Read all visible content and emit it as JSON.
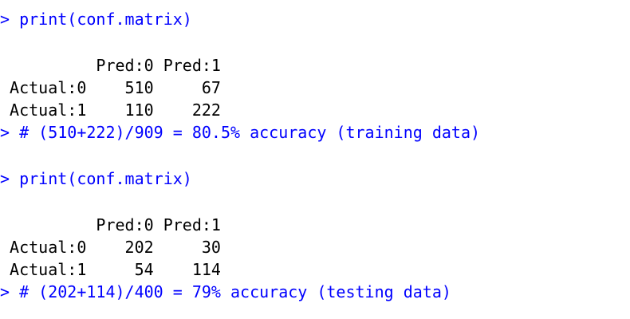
{
  "console": {
    "blocks": [
      {
        "command": "> print(conf.matrix)",
        "header": "          Pred:0 Pred:1",
        "rows": [
          " Actual:0    510     67",
          " Actual:1    110    222"
        ],
        "comment": "> # (510+222)/909 = 80.5% accuracy (training data)"
      },
      {
        "command": "> print(conf.matrix)",
        "header": "          Pred:0 Pred:1",
        "rows": [
          " Actual:0    202     30",
          " Actual:1     54    114"
        ],
        "comment": "> # (202+114)/400 = 79% accuracy (testing data)"
      }
    ]
  },
  "colors": {
    "command_text": "#0000ff",
    "output_text": "#000000",
    "background": "#ffffff"
  }
}
